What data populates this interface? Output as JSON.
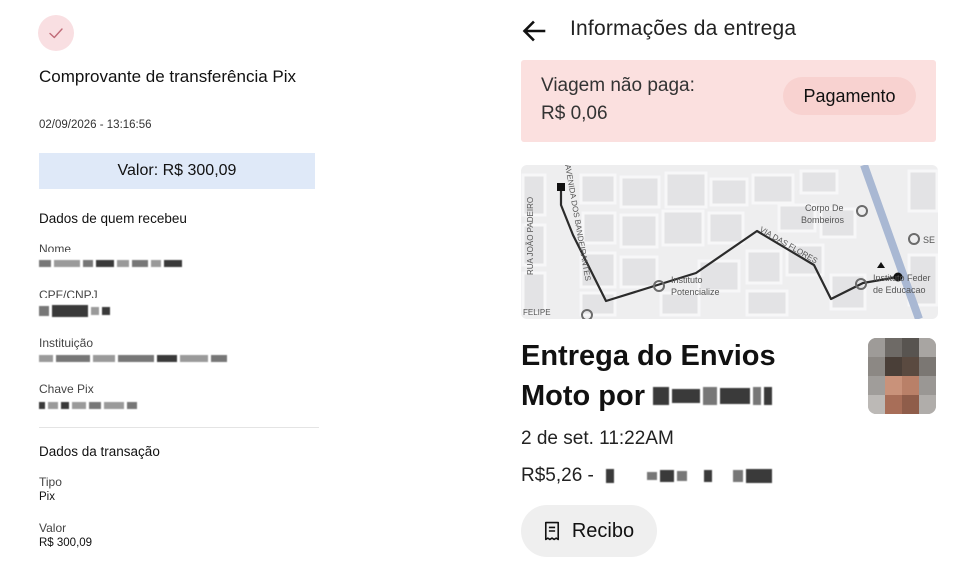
{
  "receipt": {
    "check_icon": "check-icon",
    "title": "Comprovante de transferência Pix",
    "datetime": "02/09/2026 - 13:16:56",
    "amount_label": "Valor: R$ 300,09",
    "recipient_section": "Dados de quem recebeu",
    "fields": {
      "name_label": "Nome",
      "doc_label": "CPF/CNPJ",
      "institution_label": "Instituição",
      "pix_key_label": "Chave Pix"
    },
    "transaction_section": "Dados da transação",
    "type_label": "Tipo",
    "type_value": "Pix",
    "value_label": "Valor",
    "value_value": "R$ 300,09"
  },
  "app": {
    "back_icon": "arrow-left-icon",
    "title": "Informações da entrega",
    "unpaid_line1": "Viagem não paga:",
    "unpaid_line2": "R$ 0,06",
    "payment_button": "Pagamento",
    "map": {
      "labels": {
        "street_vertical": "RUA JOÃO PADEIRO",
        "street_bandeirantes": "AVENIDA DOS BANDEIRANTES",
        "street_flores": "VIA DAS FLORES",
        "street_felipe": "FELIPE",
        "poi_bombeiros_1": "Corpo De",
        "poi_bombeiros_2": "Bombeiros",
        "poi_instituto_1": "Instituto",
        "poi_instituto_2": "Potencialize",
        "poi_federal_1": "Instituto Feder",
        "poi_federal_2": "de Educacao",
        "poi_se": "SE"
      }
    },
    "trip_title_line1": "Entrega do Envios",
    "trip_title_line2": "Moto por",
    "trip_date": "2 de set. 11:22AM",
    "trip_price": "R$5,26 -",
    "receipt_button": "Recibo",
    "receipt_icon": "receipt-icon",
    "colors": {
      "unpaid_bg": "#fbe0df",
      "pay_button_bg": "#f8d2d0",
      "route": "#2b2b2b",
      "highway": "#a9b8d3"
    }
  }
}
